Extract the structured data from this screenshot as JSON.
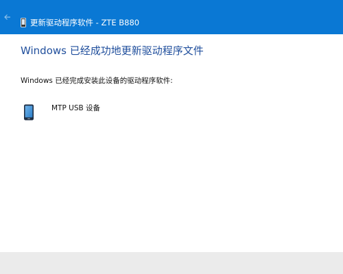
{
  "window": {
    "title": "更新驱动程序软件 - ZTE B880"
  },
  "titlebar": {
    "back_icon": "back-arrow-icon",
    "device_icon": "phone-icon",
    "background_color": "#0a78d4"
  },
  "main": {
    "heading": "Windows 已经成功地更新驱动程序文件",
    "description": "Windows 已经完成安装此设备的驱动程序软件:",
    "device": {
      "name": "MTP USB 设备",
      "icon": "mobile-device-icon"
    }
  },
  "colors": {
    "heading": "#1f4e9c",
    "footer": "#ebebeb"
  }
}
